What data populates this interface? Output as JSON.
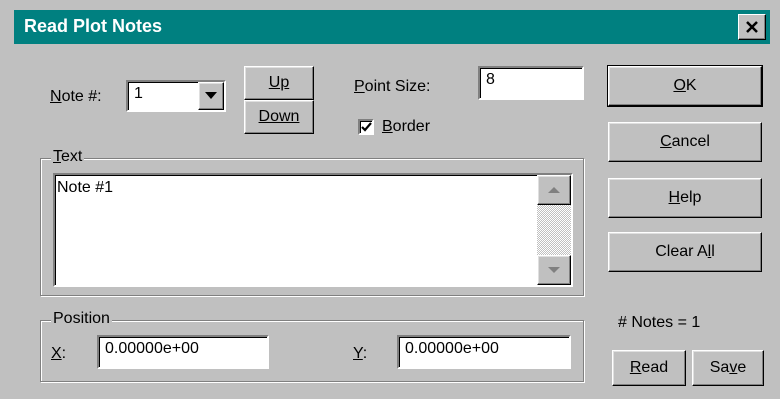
{
  "window": {
    "title": "Read Plot Notes"
  },
  "note_number": {
    "label_pre": "N",
    "label_mid": "ote #:",
    "value": "1"
  },
  "buttons": {
    "up": "Up",
    "down": "Down",
    "ok_u": "O",
    "ok_rest": "K",
    "cancel_u": "C",
    "cancel_rest": "ancel",
    "help_u": "H",
    "help_rest": "elp",
    "clear_pre": "Clear A",
    "clear_u": "l",
    "clear_rest": "l",
    "read_u": "R",
    "read_rest": "ead",
    "save_pre": "Sa",
    "save_u": "v",
    "save_rest": "e"
  },
  "point_size": {
    "label_u": "P",
    "label_rest": "oint Size:",
    "value": "8"
  },
  "border": {
    "checked": true,
    "label_u": "B",
    "label_rest": "order"
  },
  "text_group": {
    "label_u": "T",
    "label_rest": "ext",
    "content": "Note #1"
  },
  "position_group": {
    "label": "Position",
    "x_label_u": "X",
    "x_label_rest": ":",
    "x_value": "0.00000e+00",
    "y_label_u": "Y",
    "y_label_rest": ":",
    "y_value": "0.00000e+00"
  },
  "notes_count": "# Notes = 1"
}
